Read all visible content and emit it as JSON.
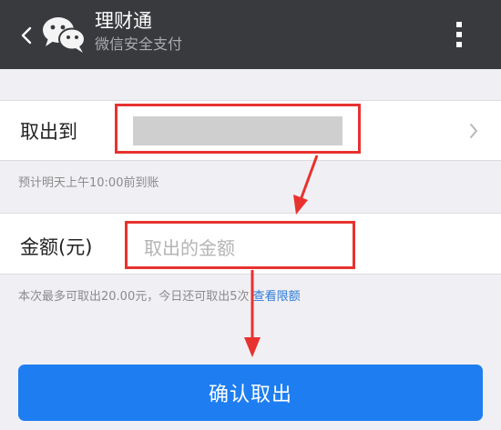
{
  "header": {
    "title": "理财通",
    "subtitle": "微信安全支付",
    "icons": [
      "back-chevron-icon",
      "wechat-logo-icon",
      "more-vertical-icon"
    ],
    "background": "#383a3e"
  },
  "destination": {
    "label": "取出到"
  },
  "arrival_hint": "预计明天上午10:00前到账",
  "amount": {
    "label": "金额(元)",
    "placeholder": "取出的金额"
  },
  "limit_hint": {
    "text": "本次最多可取出20.00元，今日还可取出5次",
    "link": "查看限额"
  },
  "confirm_button": {
    "label": "确认取出"
  },
  "colors": {
    "accent": "#1e7ef1",
    "link": "#2c7ad6",
    "annotation": "#e8322f"
  }
}
